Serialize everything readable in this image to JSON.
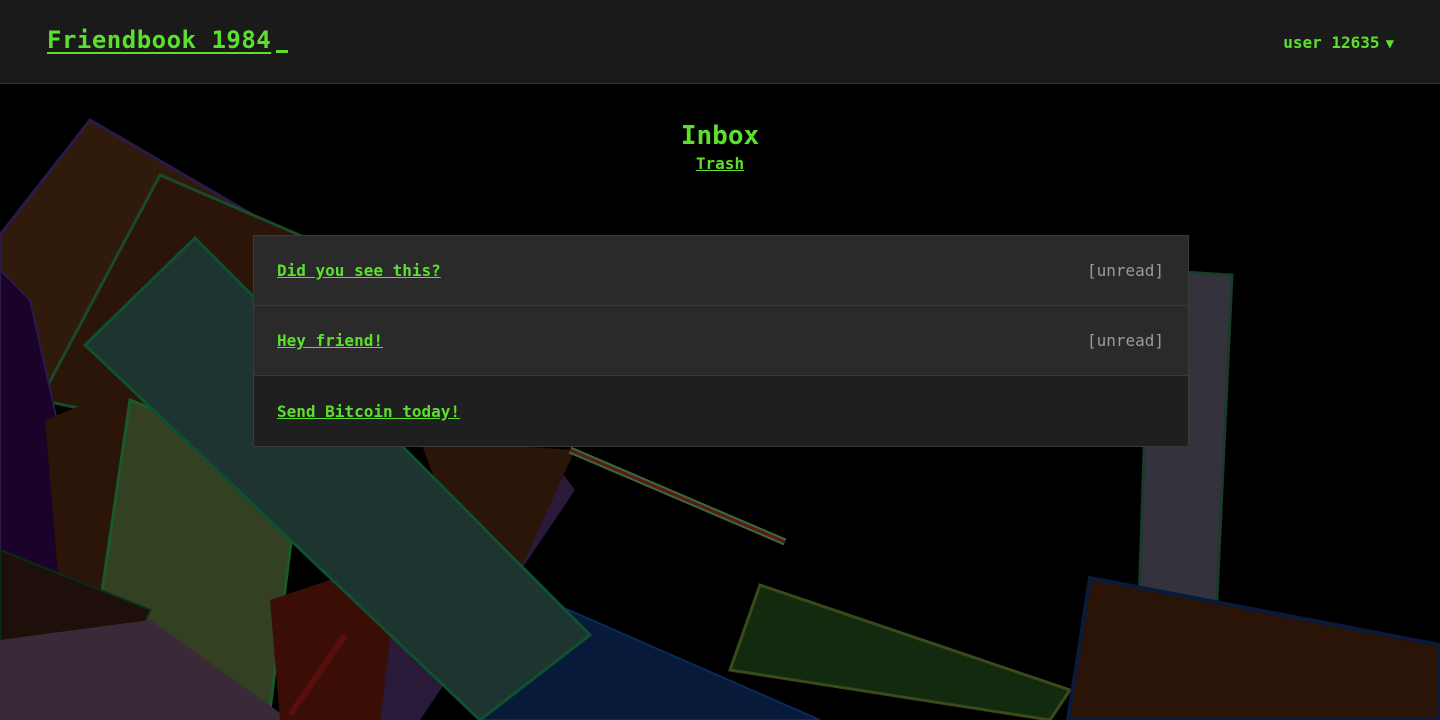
{
  "header": {
    "app_title": "Friendbook 1984",
    "user_label": "user 12635",
    "user_chevron": "▼"
  },
  "page": {
    "title": "Inbox",
    "trash_link": "Trash"
  },
  "messages": [
    {
      "subject": "Did you see this?",
      "status": "[unread]"
    },
    {
      "subject": "Hey friend!",
      "status": "[unread]"
    },
    {
      "subject": "Send Bitcoin today!",
      "status": ""
    }
  ],
  "colors": {
    "accent": "#5ce02e",
    "header_bg": "#1a1a1a",
    "panel_bg": "#2a2a2a",
    "muted_text": "#9a9a9a"
  }
}
